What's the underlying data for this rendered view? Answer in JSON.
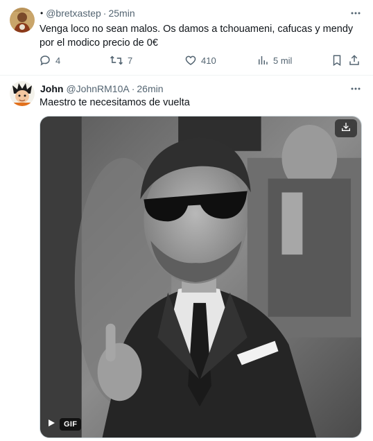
{
  "tweets": [
    {
      "display_name": "",
      "bullet": "•",
      "handle": "@bretxastep",
      "separator": "·",
      "time": "25min",
      "text": "Venga loco no sean malos. Os damos a tchouameni, cafucas y mendy por el modico precio de 0€",
      "actions": {
        "replies": "4",
        "retweets": "7",
        "likes": "410",
        "views": "5 mil"
      },
      "icons": [
        "more-icon",
        "reply-icon",
        "retweet-icon",
        "like-icon",
        "views-icon",
        "bookmark-icon",
        "share-icon"
      ]
    },
    {
      "display_name": "John",
      "handle": "@JohnRM10A",
      "separator": "·",
      "time": "26min",
      "text": "Maestro te necesitamos de vuelta",
      "media": {
        "type": "gif",
        "badge": "GIF",
        "icons": [
          "download-icon",
          "play-icon"
        ]
      }
    }
  ],
  "colors": {
    "text_primary": "#0f1419",
    "text_secondary": "#536471",
    "border": "#eff3f4"
  }
}
